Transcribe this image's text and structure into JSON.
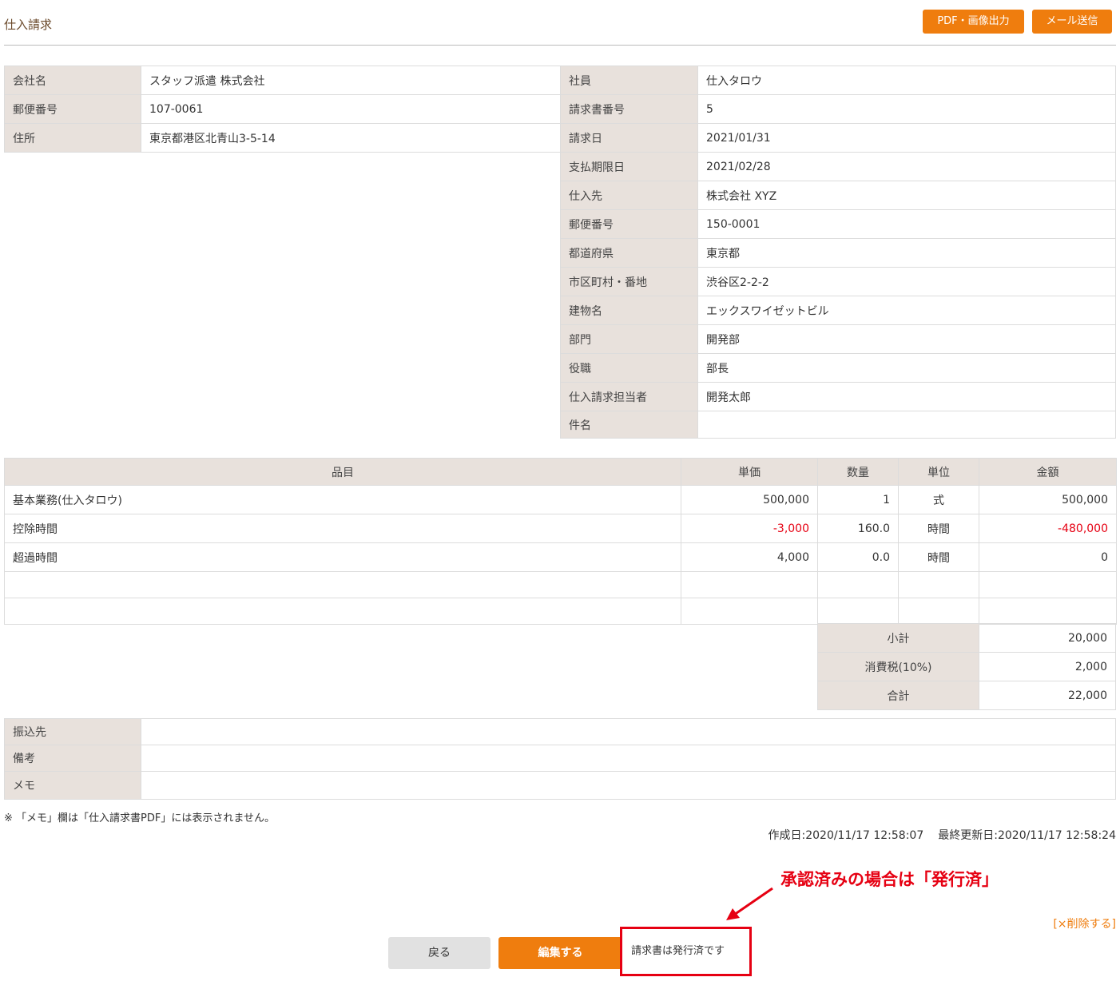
{
  "header": {
    "title": "仕入請求",
    "pdf_button": "PDF・画像出力",
    "mail_button": "メール送信"
  },
  "company": [
    {
      "label": "会社名",
      "value": "スタッフ派遣 株式会社"
    },
    {
      "label": "郵便番号",
      "value": "107-0061"
    },
    {
      "label": "住所",
      "value": "東京都港区北青山3-5-14"
    }
  ],
  "detail": [
    {
      "label": "社員",
      "value": "仕入タロウ"
    },
    {
      "label": "請求書番号",
      "value": "5"
    },
    {
      "label": "請求日",
      "value": "2021/01/31"
    },
    {
      "label": "支払期限日",
      "value": "2021/02/28"
    },
    {
      "label": "仕入先",
      "value": "株式会社 XYZ"
    },
    {
      "label": "郵便番号",
      "value": "150-0001"
    },
    {
      "label": "都道府県",
      "value": "東京都"
    },
    {
      "label": "市区町村・番地",
      "value": "渋谷区2-2-2"
    },
    {
      "label": "建物名",
      "value": "エックスワイゼットビル"
    },
    {
      "label": "部門",
      "value": "開発部"
    },
    {
      "label": "役職",
      "value": "部長"
    },
    {
      "label": "仕入請求担当者",
      "value": "開発太郎"
    },
    {
      "label": "件名",
      "value": ""
    }
  ],
  "items": {
    "headers": [
      "品目",
      "単価",
      "数量",
      "単位",
      "金額"
    ],
    "rows": [
      {
        "name": "基本業務(仕入タロウ)",
        "price": "500,000",
        "qty": "1",
        "unit": "式",
        "amount": "500,000"
      },
      {
        "name": "控除時間",
        "price": "-3,000",
        "qty": "160.0",
        "unit": "時間",
        "amount": "-480,000"
      },
      {
        "name": "超過時間",
        "price": "4,000",
        "qty": "0.0",
        "unit": "時間",
        "amount": "0"
      }
    ]
  },
  "totals": [
    {
      "label": "小計",
      "value": "20,000"
    },
    {
      "label": "消費税(10%)",
      "value": "2,000"
    },
    {
      "label": "合計",
      "value": "22,000"
    }
  ],
  "notes": [
    {
      "label": "振込先",
      "value": ""
    },
    {
      "label": "備考",
      "value": ""
    },
    {
      "label": "メモ",
      "value": ""
    }
  ],
  "memo_note": "※ 「メモ」欄は「仕入請求書PDF」には表示されません。",
  "created": "作成日:2020/11/17 12:58:07",
  "updated": "最終更新日:2020/11/17 12:58:24",
  "annotation": "承認済みの場合は「発行済」",
  "delete_link": "[×削除する]",
  "back_button": "戻る",
  "edit_button": "編集する",
  "status_text": "請求書は発行済です",
  "colors": {
    "accent": "#ef7d0e",
    "label_bg": "#e8e1dc",
    "negative": "#e60012"
  }
}
